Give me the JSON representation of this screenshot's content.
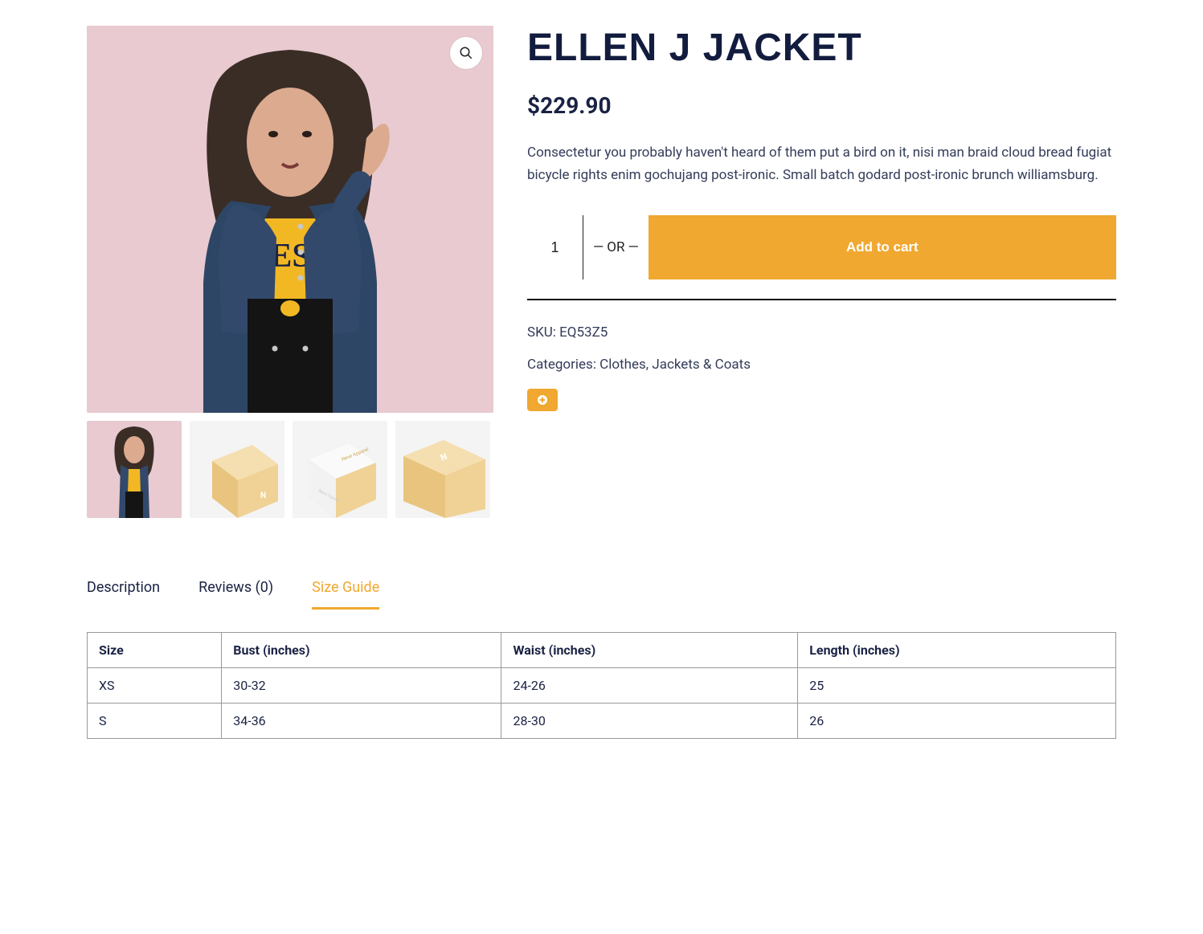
{
  "product": {
    "title": "ELLEN J JACKET",
    "price": "$229.90",
    "description": "Consectetur you probably haven't heard of them put a bird on it, nisi man braid cloud bread fugiat bicycle rights enim gochujang post-ironic. Small batch godard post-ironic brunch williamsburg.",
    "qty": "1",
    "or_text": "OR",
    "add_to_cart": "Add to cart",
    "sku_label": "SKU: ",
    "sku": "EQ53Z5",
    "categories_label": "Categories: ",
    "categories": "Clothes, Jackets & Coats"
  },
  "tabs": {
    "description": "Description",
    "reviews": "Reviews (0)",
    "size_guide": "Size Guide"
  },
  "size_table": {
    "headers": [
      "Size",
      "Bust (inches)",
      "Waist (inches)",
      "Length (inches)"
    ],
    "rows": [
      [
        "XS",
        "30-32",
        "24-26",
        "25"
      ],
      [
        "S",
        "34-36",
        "28-30",
        "26"
      ]
    ]
  }
}
